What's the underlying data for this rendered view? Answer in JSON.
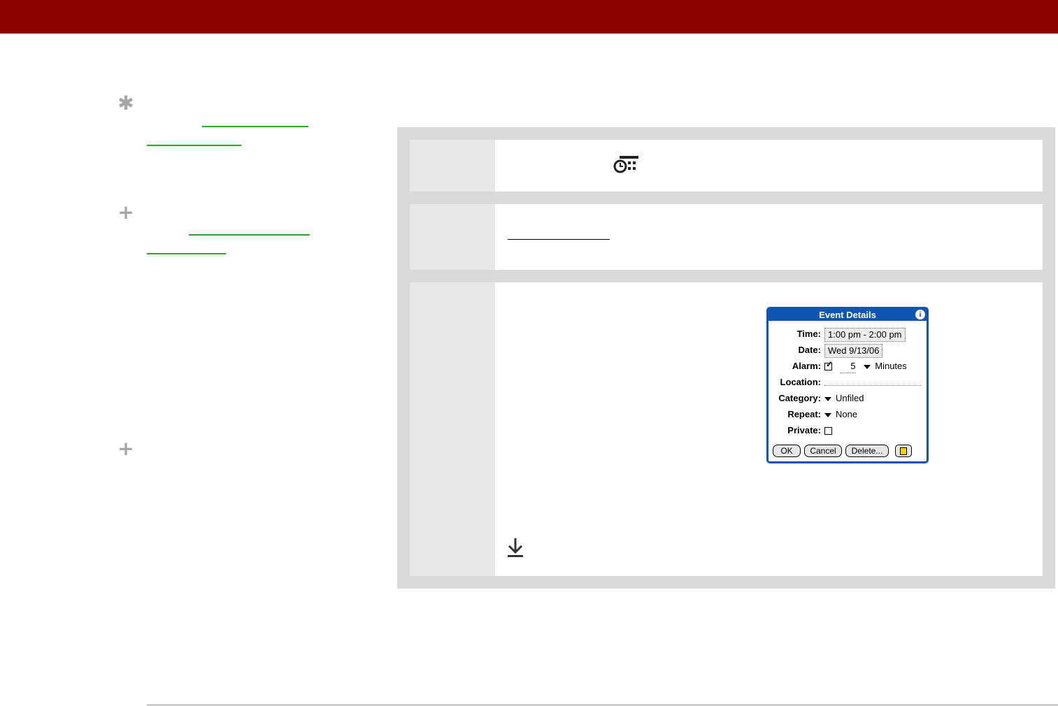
{
  "dialog": {
    "title": "Event Details",
    "info_icon": "i",
    "time_label": "Time:",
    "time_value": "1:00 pm - 2:00 pm",
    "date_label": "Date:",
    "date_value": "Wed 9/13/06",
    "alarm_label": "Alarm:",
    "alarm_checked": true,
    "alarm_amount": "5",
    "alarm_unit": "Minutes",
    "location_label": "Location:",
    "location_value": "",
    "category_label": "Category:",
    "category_value": "Unfiled",
    "repeat_label": "Repeat:",
    "repeat_value": "None",
    "private_label": "Private:",
    "private_checked": false,
    "buttons": {
      "ok": "OK",
      "cancel": "Cancel",
      "delete": "Delete..."
    }
  },
  "icons": {
    "tip": "asterisk-icon",
    "cross_ref_1": "plus-icon",
    "cross_ref_2": "plus-icon",
    "calendar_app": "calendar-clock-icon",
    "done": "download-arrow-icon",
    "note": "note-icon"
  },
  "colors": {
    "header_bar": "#8b0000",
    "link": "#2fa52f",
    "dialog_accent": "#1155b4",
    "panel_bg": "#d9d9d9",
    "step_number_bg": "#e8e8e8",
    "side_icon": "#a6a6a6"
  }
}
